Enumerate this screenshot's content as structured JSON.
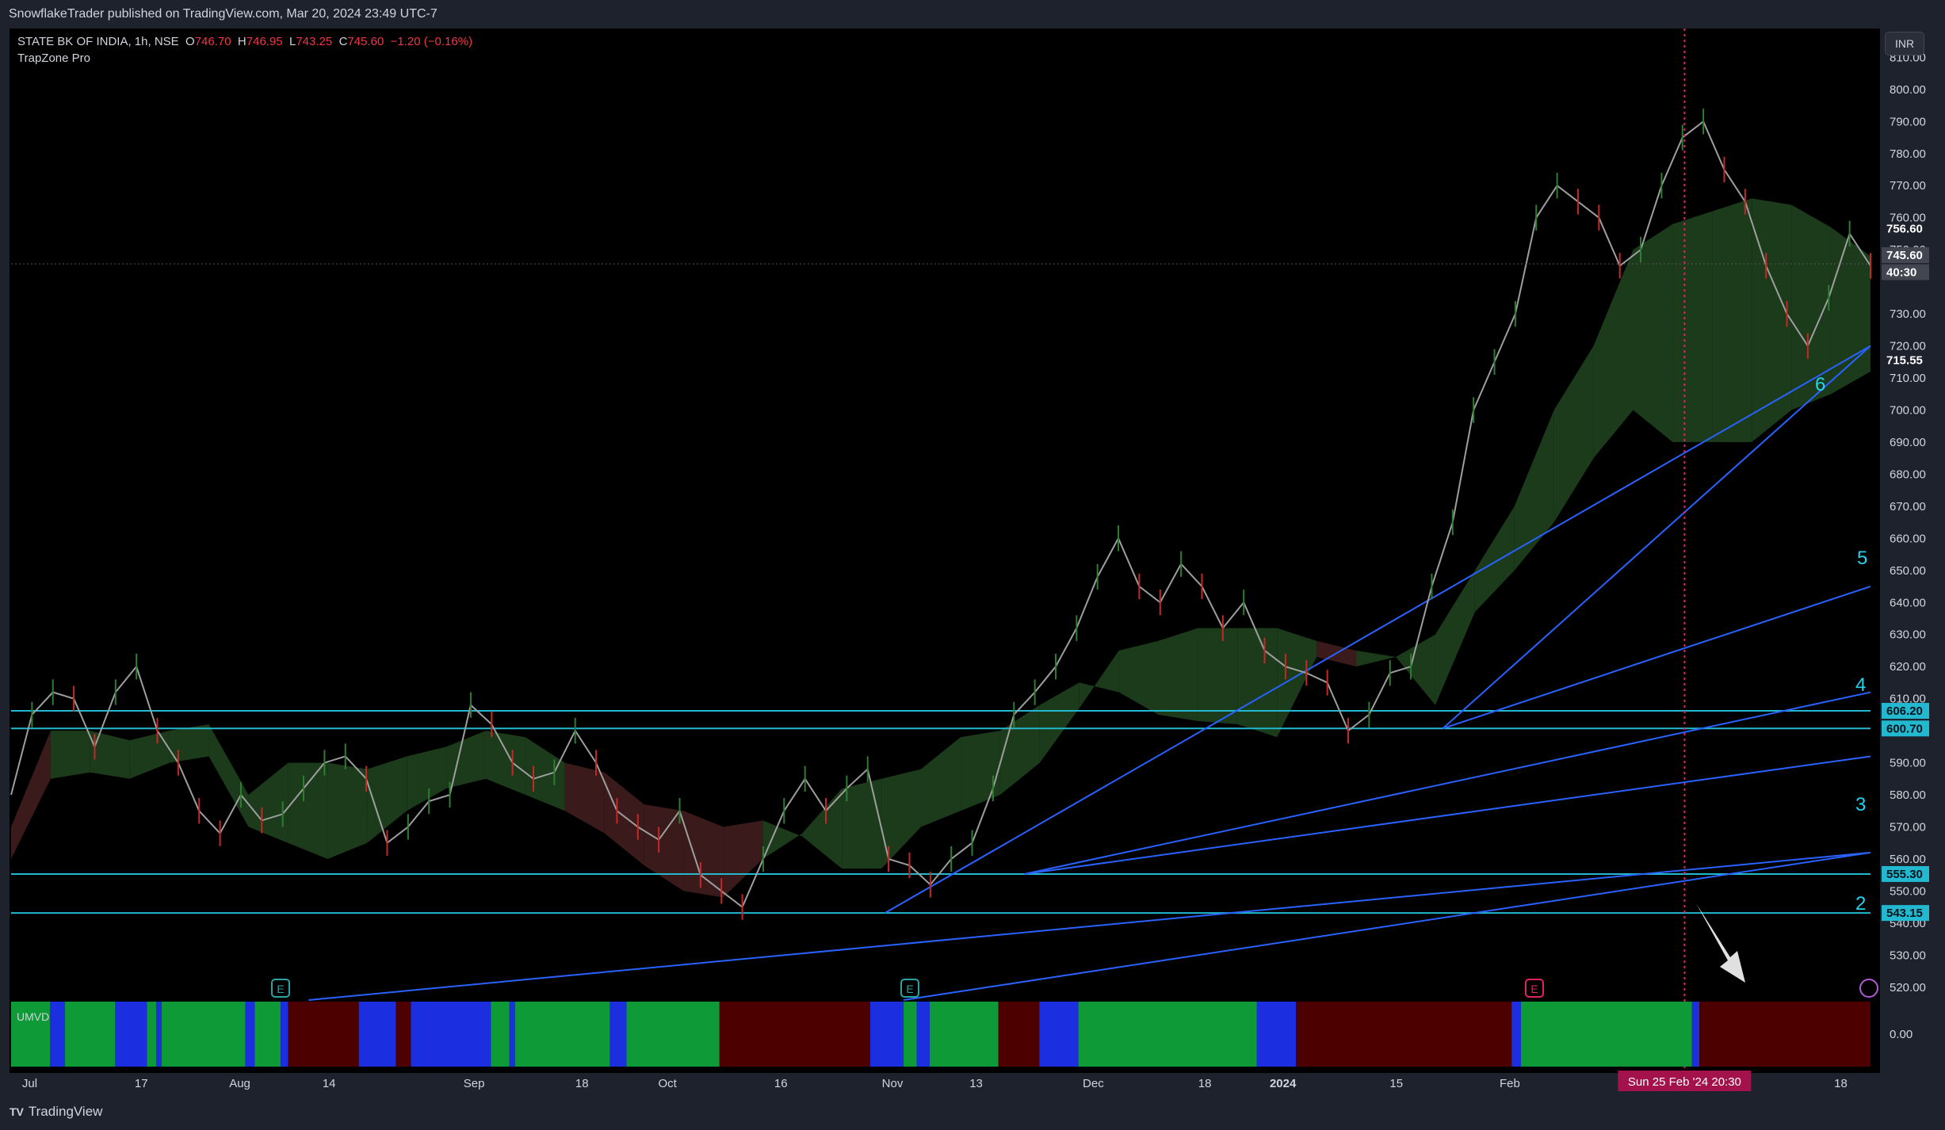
{
  "header": {
    "attribution": "SnowflakeTrader published on TradingView.com, Mar 20, 2024 23:49 UTC-7"
  },
  "legend": {
    "symbol": "STATE BK OF INDIA, 1h, NSE",
    "o_label": "O",
    "o_value": "746.70",
    "h_label": "H",
    "h_value": "746.95",
    "l_label": "L",
    "l_value": "743.25",
    "c_label": "C",
    "c_value": "745.60",
    "change": "−1.20 (−0.16%)",
    "indicator": "TrapZone Pro"
  },
  "currency_button": "INR",
  "footer": {
    "logo_text": "TradingView"
  },
  "colors": {
    "background": "#000000",
    "cyan_level": "#22b8cf",
    "trendline": "#2962ff",
    "wave_label": "#22d3ee",
    "cloud_green": "#1b3b1b",
    "cloud_red": "#3a1a1a",
    "candle_up": "#9e9e9e",
    "candle_green": "#2e7d32",
    "candle_red": "#c62828",
    "umvd_green": "#0e9a36",
    "umvd_blue": "#1b2ee0",
    "umvd_red": "#4d0000",
    "crosshair": "#e91e63"
  },
  "chart_data": {
    "type": "line",
    "title": "STATE BK OF INDIA, 1h, NSE",
    "ylim": [
      516,
      818
    ],
    "y_ticks": [
      "810.00",
      "800.00",
      "790.00",
      "780.00",
      "770.00",
      "760.00",
      "750.00",
      "730.00",
      "720.00",
      "710.00",
      "700.00",
      "690.00",
      "680.00",
      "670.00",
      "660.00",
      "650.00",
      "640.00",
      "630.00",
      "620.00",
      "610.00",
      "590.00",
      "580.00",
      "570.00",
      "560.00",
      "550.00",
      "540.00",
      "530.00",
      "520.00"
    ],
    "x_ticks": [
      "Jul",
      "17",
      "Aug",
      "14",
      "Sep",
      "18",
      "Oct",
      "16",
      "Nov",
      "13",
      "Dec",
      "18",
      "2024",
      "15",
      "Feb",
      "18"
    ],
    "series": [
      {
        "values": [
          580,
          605,
          612,
          610,
          595,
          612,
          620,
          600,
          590,
          575,
          568,
          580,
          572,
          574,
          582,
          590,
          592,
          585,
          565,
          570,
          578,
          580,
          608,
          602,
          590,
          585,
          587,
          600,
          590,
          575,
          570,
          566,
          575,
          555,
          550,
          545,
          560,
          575,
          585,
          575,
          582,
          588,
          560,
          558,
          552,
          560,
          565,
          582,
          605,
          612,
          620,
          632,
          648,
          660,
          645,
          640,
          652,
          645,
          632,
          640,
          625,
          620,
          618,
          615,
          600,
          605,
          618,
          620,
          645,
          665,
          700,
          715,
          730,
          760,
          770,
          765,
          760,
          745,
          750,
          770,
          785,
          790,
          775,
          765,
          745,
          730,
          720,
          735,
          755,
          745
        ]
      }
    ],
    "cloud_upper": [
      570,
      600,
      600,
      597,
      600,
      602,
      580,
      590,
      590,
      588,
      592,
      595,
      600,
      598,
      590,
      587,
      577,
      575,
      570,
      572,
      567,
      557,
      557,
      570,
      575,
      580,
      590,
      607,
      625,
      628,
      632,
      632,
      632,
      628,
      625,
      623,
      630,
      650,
      670,
      700,
      720,
      750,
      758,
      762,
      766,
      764,
      757,
      748
    ],
    "cloud_lower": [
      560,
      585,
      587,
      585,
      590,
      592,
      570,
      565,
      560,
      565,
      575,
      582,
      585,
      580,
      575,
      568,
      558,
      550,
      548,
      560,
      568,
      582,
      585,
      588,
      598,
      600,
      608,
      615,
      612,
      605,
      603,
      602,
      598,
      623,
      620,
      623,
      608,
      637,
      650,
      665,
      685,
      700,
      690,
      690,
      690,
      700,
      705,
      712
    ],
    "horizontal_levels": [
      606.2,
      600.7,
      555.3,
      543.15
    ],
    "price_labels": [
      "756.60",
      "745.60",
      "40:30",
      "715.55",
      "606.20",
      "600.70",
      "555.30",
      "543.15"
    ],
    "wave_labels": [
      "2",
      "3",
      "4",
      "5",
      "6"
    ],
    "crosshair_label": "Sun 25 Feb '24   20:30",
    "umvd": {
      "name": "UMVD",
      "value_label": "0.00",
      "segments": [
        {
          "state": "green",
          "from": 0.0,
          "to": 0.021
        },
        {
          "state": "blue",
          "from": 0.021,
          "to": 0.029
        },
        {
          "state": "green",
          "from": 0.029,
          "to": 0.056
        },
        {
          "state": "blue",
          "from": 0.056,
          "to": 0.073
        },
        {
          "state": "green",
          "from": 0.073,
          "to": 0.078
        },
        {
          "state": "blue",
          "from": 0.078,
          "to": 0.081
        },
        {
          "state": "green",
          "from": 0.081,
          "to": 0.126
        },
        {
          "state": "blue",
          "from": 0.126,
          "to": 0.131
        },
        {
          "state": "green",
          "from": 0.131,
          "to": 0.145
        },
        {
          "state": "blue",
          "from": 0.145,
          "to": 0.149
        },
        {
          "state": "red",
          "from": 0.149,
          "to": 0.187
        },
        {
          "state": "blue",
          "from": 0.187,
          "to": 0.207
        },
        {
          "state": "red",
          "from": 0.207,
          "to": 0.215
        },
        {
          "state": "blue",
          "from": 0.215,
          "to": 0.258
        },
        {
          "state": "green",
          "from": 0.258,
          "to": 0.268
        },
        {
          "state": "blue",
          "from": 0.268,
          "to": 0.271
        },
        {
          "state": "green",
          "from": 0.271,
          "to": 0.322
        },
        {
          "state": "blue",
          "from": 0.322,
          "to": 0.331
        },
        {
          "state": "green",
          "from": 0.331,
          "to": 0.381
        },
        {
          "state": "red",
          "from": 0.381,
          "to": 0.462
        },
        {
          "state": "blue",
          "from": 0.462,
          "to": 0.48
        },
        {
          "state": "green",
          "from": 0.48,
          "to": 0.487
        },
        {
          "state": "blue",
          "from": 0.487,
          "to": 0.494
        },
        {
          "state": "green",
          "from": 0.494,
          "to": 0.531
        },
        {
          "state": "red",
          "from": 0.531,
          "to": 0.553
        },
        {
          "state": "blue",
          "from": 0.553,
          "to": 0.574
        },
        {
          "state": "green",
          "from": 0.574,
          "to": 0.67
        },
        {
          "state": "blue",
          "from": 0.67,
          "to": 0.691
        },
        {
          "state": "red",
          "from": 0.691,
          "to": 0.807
        },
        {
          "state": "blue",
          "from": 0.807,
          "to": 0.812
        },
        {
          "state": "green",
          "from": 0.812,
          "to": 0.904
        },
        {
          "state": "blue",
          "from": 0.904,
          "to": 0.908
        },
        {
          "state": "red",
          "from": 0.908,
          "to": 1.0
        }
      ]
    }
  }
}
